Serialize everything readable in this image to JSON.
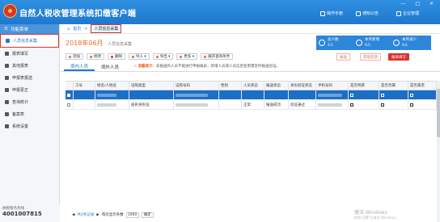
{
  "header": {
    "title": "自然人税收管理系统扣缴客户端",
    "buttons": [
      {
        "label": "操作手册",
        "icon": "book-icon"
      },
      {
        "label": "通知公告",
        "icon": "notice-icon"
      },
      {
        "label": "企业管理",
        "icon": "company-icon"
      }
    ],
    "window_controls": "— □ ×"
  },
  "sidebar": {
    "header": "功能菜单",
    "items": [
      {
        "label": "人员信息采集",
        "icon": "person-icon",
        "active": true
      },
      {
        "label": "报表填写",
        "icon": "report-icon"
      },
      {
        "label": "其他报表",
        "icon": "other-report-icon"
      },
      {
        "label": "申报表报送",
        "icon": "submit-icon"
      },
      {
        "label": "申报更正",
        "icon": "correct-icon"
      },
      {
        "label": "查询统计",
        "icon": "query-icon"
      },
      {
        "label": "备案表",
        "icon": "record-icon"
      },
      {
        "label": "系统设置",
        "icon": "settings-icon"
      }
    ],
    "footer_label": "纳税服务热线",
    "footer_number": "4001007815"
  },
  "breadcrumb": {
    "home": "首页",
    "current": "人员信息采集"
  },
  "page": {
    "year_title": "2018年06月",
    "subtitle": "人员信息采集",
    "stats": [
      {
        "label": "总人数",
        "value": "2人"
      },
      {
        "label": "本月新增",
        "value": "0人"
      },
      {
        "label": "本月减少",
        "value": "0人"
      }
    ],
    "actions": [
      "报送",
      "获取反馈",
      "报表填写"
    ]
  },
  "toolbar": [
    {
      "label": "添加",
      "color": "#e8702a"
    },
    {
      "label": "修改",
      "color": "#e8702a"
    },
    {
      "label": "删除",
      "color": "#d7332a"
    },
    {
      "label": "导入 ▾",
      "color": "#e8702a"
    },
    {
      "label": "导出 ▾",
      "color": "#e8702a"
    },
    {
      "label": "更多 ▾",
      "color": "#e8702a"
    },
    {
      "label": "展开查询条件",
      "color": "#e8702a"
    }
  ],
  "tabs": [
    "境内人员",
    "境外人员"
  ],
  "tip": {
    "warn": "温馨提示：",
    "text": "非报送的人员不能进行申报报表，新增人员或人员信息变更需及时报送验证。"
  },
  "grid": {
    "columns": [
      "",
      "工号",
      "姓名/人姓名",
      "证照类型",
      "证照号码",
      "性别",
      "人员状态",
      "报送状态",
      "身份验证状态",
      "手机号码",
      "是否残疾",
      "是否烈属",
      "是否孤老"
    ],
    "rows": [
      {
        "selected": true,
        "cells": [
          "",
          "",
          "",
          "",
          "",
          "",
          "",
          "",
          "",
          ""
        ]
      },
      {
        "selected": false,
        "cells": [
          "",
          "",
          "居民身份证",
          "",
          "",
          "正常",
          "报送成功",
          "验证通过",
          "",
          ""
        ]
      }
    ]
  },
  "pager": {
    "first": "共2条记录",
    "per_page_label": "每页显示条数",
    "per_page": "1000",
    "go": "确定"
  },
  "watermark": {
    "title": "激活 Windows",
    "sub": "转到\"设置\"以激活 Windows。"
  }
}
